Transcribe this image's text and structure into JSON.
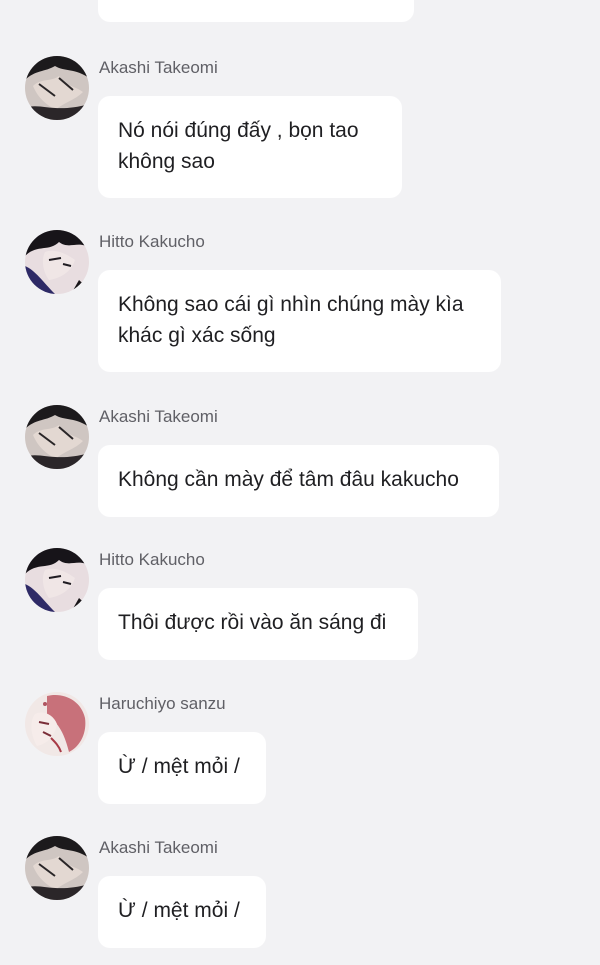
{
  "messages": [
    {
      "sender": "Akashi Takeomi",
      "avatar": "akashi-avatar",
      "lines": [
        "Nó nói đúng đấy , bọn tao",
        "không sao"
      ]
    },
    {
      "sender": "Hitto Kakucho",
      "avatar": "kakucho-avatar",
      "lines": [
        "Không sao cái gì nhìn chúng mày kìa",
        "khác gì xác sống"
      ]
    },
    {
      "sender": "Akashi Takeomi",
      "avatar": "akashi-avatar",
      "lines": [
        "Không cần mày để tâm đâu kakucho"
      ]
    },
    {
      "sender": "Hitto Kakucho",
      "avatar": "kakucho-avatar",
      "lines": [
        "Thôi được rồi vào ăn sáng đi"
      ]
    },
    {
      "sender": "Haruchiyo sanzu",
      "avatar": "sanzu-avatar",
      "lines": [
        "Ừ / mệt mỏi /"
      ]
    },
    {
      "sender": "Akashi Takeomi",
      "avatar": "akashi-avatar",
      "lines": [
        "Ừ / mệt mỏi /"
      ]
    }
  ],
  "colors": {
    "background": "#f2f2f4",
    "bubble": "#ffffff",
    "sender_text": "#606066",
    "message_text": "#1f1f22"
  }
}
